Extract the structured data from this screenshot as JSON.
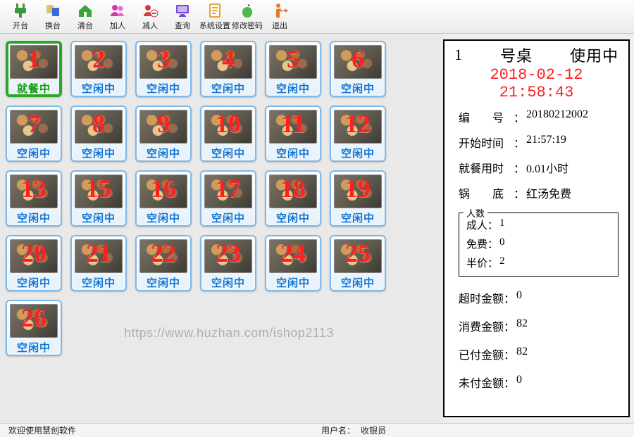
{
  "toolbar": [
    {
      "name": "open-table",
      "label": "开台",
      "icon": "plug"
    },
    {
      "name": "swap-table",
      "label": "换台",
      "icon": "swap"
    },
    {
      "name": "clear-table",
      "label": "清台",
      "icon": "home"
    },
    {
      "name": "add-person",
      "label": "加人",
      "icon": "people"
    },
    {
      "name": "sub-person",
      "label": "减人",
      "icon": "people-minus"
    },
    {
      "name": "query",
      "label": "查询",
      "icon": "monitor"
    },
    {
      "name": "sys-settings",
      "label": "系统设置",
      "icon": "note"
    },
    {
      "name": "change-pwd",
      "label": "修改密码",
      "icon": "apple"
    },
    {
      "name": "exit",
      "label": "退出",
      "icon": "person-exit"
    }
  ],
  "status_labels": {
    "idle": "空闲中",
    "busy": "就餐中"
  },
  "tables": [
    {
      "n": 1,
      "status": "busy",
      "selected": true
    },
    {
      "n": 2,
      "status": "idle"
    },
    {
      "n": 3,
      "status": "idle"
    },
    {
      "n": 4,
      "status": "idle"
    },
    {
      "n": 5,
      "status": "idle"
    },
    {
      "n": 6,
      "status": "idle"
    },
    {
      "n": 7,
      "status": "idle"
    },
    {
      "n": 8,
      "status": "idle"
    },
    {
      "n": 9,
      "status": "idle"
    },
    {
      "n": 10,
      "status": "idle"
    },
    {
      "n": 11,
      "status": "idle"
    },
    {
      "n": 12,
      "status": "idle"
    },
    {
      "n": 13,
      "status": "idle"
    },
    {
      "n": 15,
      "status": "idle"
    },
    {
      "n": 16,
      "status": "idle"
    },
    {
      "n": 17,
      "status": "idle"
    },
    {
      "n": 18,
      "status": "idle"
    },
    {
      "n": 19,
      "status": "idle"
    },
    {
      "n": 20,
      "status": "idle"
    },
    {
      "n": 21,
      "status": "idle"
    },
    {
      "n": 22,
      "status": "idle"
    },
    {
      "n": 23,
      "status": "idle"
    },
    {
      "n": 24,
      "status": "idle"
    },
    {
      "n": 25,
      "status": "idle"
    },
    {
      "n": 26,
      "status": "idle"
    }
  ],
  "watermark": "https://www.huzhan.com/ishop2113",
  "detail": {
    "title_left": "1",
    "title_mid": "号桌",
    "title_right": "使用中",
    "time": "2018-02-12 21:58:43",
    "serial_label": "编　　号",
    "serial": "20180212002",
    "start_label": "开始时间",
    "start": "21:57:19",
    "elapsed_label": "就餐用时",
    "elapsed": "0.01小时",
    "pot_label": "锅　　底",
    "pot": "红汤免费",
    "people_group_title": "人数",
    "adult_label": "成人",
    "adult": "1",
    "free_label": "免费",
    "free": "0",
    "half_label": "半价",
    "half": "2",
    "overtime_label": "超时金额",
    "overtime": "0",
    "consume_label": "消费金额",
    "consume": "82",
    "paid_label": "已付金额",
    "paid": "82",
    "unpaid_label": "未付金额",
    "unpaid": "0"
  },
  "statusbar": {
    "welcome": "欢迎使用慧创软件",
    "user_label": "用户名：",
    "user": "收银员"
  },
  "icons": {
    "plug": "#3a9a3a",
    "swap": "#3a6ad6",
    "home": "#3aa53a",
    "people": "#d63aa8",
    "people-minus": "#d63a3a",
    "monitor": "#7a4ad6",
    "note": "#e6a23a",
    "apple": "#4ab84a",
    "person-exit": "#e67a2a"
  }
}
